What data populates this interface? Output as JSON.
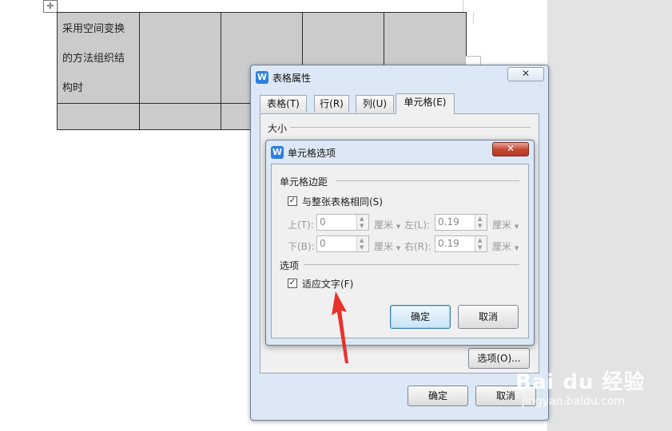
{
  "document": {
    "move_handle_icon": "move-cross-icon",
    "cell_text_lines": [
      "采用空间变换",
      "的方法组织结",
      "构时"
    ]
  },
  "table_props_dialog": {
    "title": "表格属性",
    "close_label": "✕",
    "tabs": [
      {
        "label": "表格(T)"
      },
      {
        "label": "行(R)"
      },
      {
        "label": "列(U)"
      },
      {
        "label": "单元格(E)"
      }
    ],
    "size_section": "大小",
    "options_button": "选项(O)...",
    "ok_button": "确定",
    "cancel_button": "取消"
  },
  "cell_options_dialog": {
    "title": "单元格选项",
    "close_label": "✕",
    "margins_section": "单元格边距",
    "same_as_table_label": "与整张表格相同(S)",
    "same_as_table_checked": true,
    "top_label": "上(T):",
    "top_value": "0",
    "bottom_label": "下(B):",
    "bottom_value": "0",
    "left_label": "左(L):",
    "left_value": "0.19",
    "right_label": "右(R):",
    "right_value": "0.19",
    "unit": "厘米",
    "options_section": "选项",
    "fit_text_label": "适应文字(F)",
    "fit_text_checked": true,
    "ok_button": "确定",
    "cancel_button": "取消"
  },
  "watermark": {
    "brand": "Bai du 经验",
    "url": "jingyan.baidu.com"
  },
  "colors": {
    "annotation_arrow": "#e8312b",
    "dialog_bg": "#dce8f5",
    "cell_fill": "#cbcbcb",
    "accent_icon": "#2d7fe3"
  }
}
